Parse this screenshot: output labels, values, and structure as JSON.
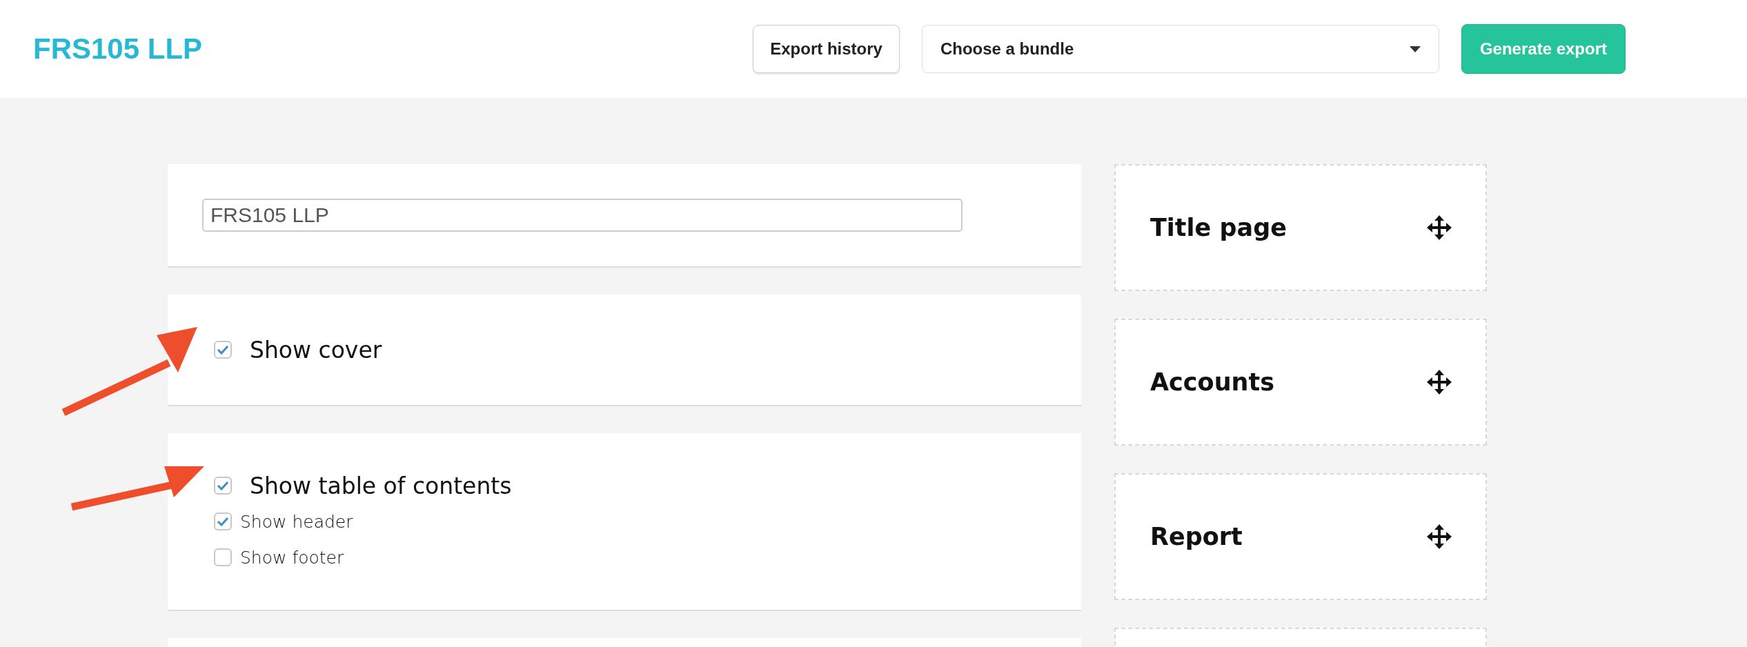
{
  "header": {
    "title": "FRS105 LLP",
    "history_button": "Export history",
    "bundle_select": {
      "placeholder": "Choose a bundle"
    },
    "generate_button": "Generate export"
  },
  "settings": [
    {
      "kind": "field",
      "value": "FRS105 LLP"
    },
    {
      "kind": "options",
      "options": [
        {
          "label": "Show cover",
          "checked": true
        }
      ]
    },
    {
      "kind": "options",
      "options": [
        {
          "label": "Show table of contents",
          "checked": true,
          "children": [
            {
              "label": "Show header",
              "checked": true
            },
            {
              "label": "Show footer",
              "checked": false
            }
          ]
        }
      ]
    },
    {
      "kind": "blank"
    }
  ],
  "sections": [
    {
      "kind": "section",
      "label": "Title page"
    },
    {
      "kind": "section",
      "label": "Accounts"
    },
    {
      "kind": "section",
      "label": "Report"
    },
    {
      "kind": "blank"
    }
  ]
}
